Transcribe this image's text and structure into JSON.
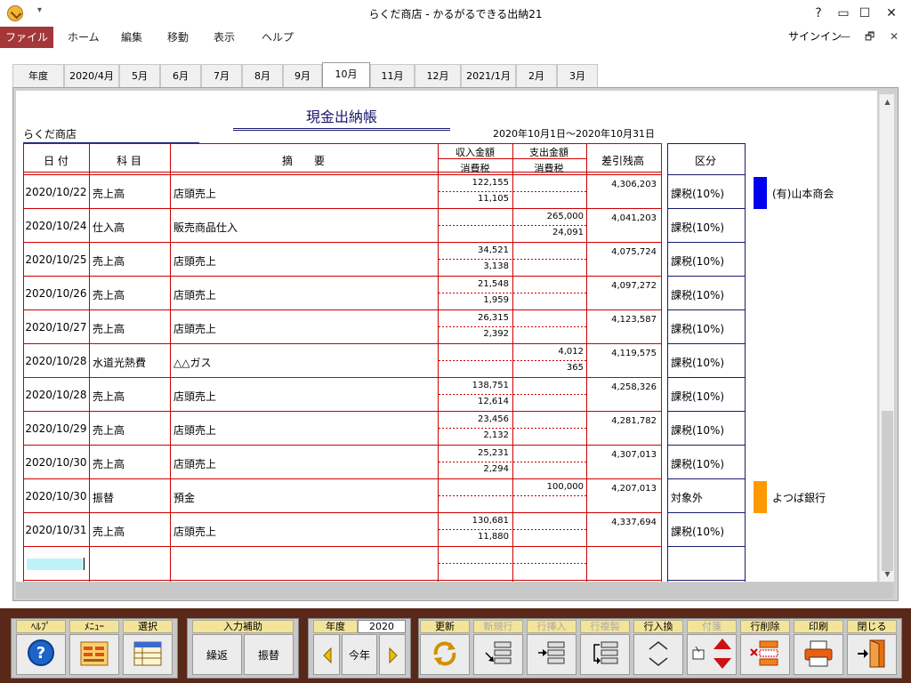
{
  "window": {
    "title": "らくだ商店 - かるがるできる出納21",
    "qat": "▾",
    "help": "?",
    "restore": "▭",
    "minimize": "—",
    "maximize": "☐",
    "close": "✕"
  },
  "menu": {
    "file": "ファイル",
    "items": [
      "ホーム",
      "編集",
      "移動",
      "表示",
      "ヘルプ"
    ],
    "signin": "サインイン",
    "min": "—",
    "restore": "🗗",
    "close": "✕"
  },
  "tabs": [
    "年度",
    "2020/4月",
    "5月",
    "6月",
    "7月",
    "8月",
    "9月",
    "10月",
    "11月",
    "12月",
    "2021/1月",
    "2月",
    "3月"
  ],
  "active_tab": "10月",
  "ledger": {
    "title": "現金出納帳",
    "shop": "らくだ商店",
    "period": "2020年10月1日～2020年10月31日",
    "headers": {
      "date": "日 付",
      "account": "科 目",
      "desc": "摘　　要",
      "income": "収入金額",
      "income_tax": "消費税",
      "expense": "支出金額",
      "expense_tax": "消費税",
      "balance": "差引残高",
      "category": "区分"
    },
    "rows": [
      {
        "date": "2020/10/22",
        "account": "売上高",
        "desc": "店頭売上",
        "income": "122,155",
        "income_tax": "11,105",
        "expense": "",
        "expense_tax": "",
        "balance": "4,306,203",
        "category": "課税(10%)",
        "partner": "(有)山本商会",
        "partner_color": "#0000ee"
      },
      {
        "date": "2020/10/24",
        "account": "仕入高",
        "desc": "販売商品仕入",
        "income": "",
        "income_tax": "",
        "expense": "265,000",
        "expense_tax": "24,091",
        "balance": "4,041,203",
        "category": "課税(10%)",
        "partner": "",
        "partner_color": ""
      },
      {
        "date": "2020/10/25",
        "account": "売上高",
        "desc": "店頭売上",
        "income": "34,521",
        "income_tax": "3,138",
        "expense": "",
        "expense_tax": "",
        "balance": "4,075,724",
        "category": "課税(10%)",
        "partner": "",
        "partner_color": ""
      },
      {
        "date": "2020/10/26",
        "account": "売上高",
        "desc": "店頭売上",
        "income": "21,548",
        "income_tax": "1,959",
        "expense": "",
        "expense_tax": "",
        "balance": "4,097,272",
        "category": "課税(10%)",
        "partner": "",
        "partner_color": ""
      },
      {
        "date": "2020/10/27",
        "account": "売上高",
        "desc": "店頭売上",
        "income": "26,315",
        "income_tax": "2,392",
        "expense": "",
        "expense_tax": "",
        "balance": "4,123,587",
        "category": "課税(10%)",
        "partner": "",
        "partner_color": ""
      },
      {
        "date": "2020/10/28",
        "account": "水道光熱費",
        "desc": "△△ガス",
        "income": "",
        "income_tax": "",
        "expense": "4,012",
        "expense_tax": "365",
        "balance": "4,119,575",
        "category": "課税(10%)",
        "partner": "",
        "partner_color": ""
      },
      {
        "date": "2020/10/28",
        "account": "売上高",
        "desc": "店頭売上",
        "income": "138,751",
        "income_tax": "12,614",
        "expense": "",
        "expense_tax": "",
        "balance": "4,258,326",
        "category": "課税(10%)",
        "partner": "",
        "partner_color": ""
      },
      {
        "date": "2020/10/29",
        "account": "売上高",
        "desc": "店頭売上",
        "income": "23,456",
        "income_tax": "2,132",
        "expense": "",
        "expense_tax": "",
        "balance": "4,281,782",
        "category": "課税(10%)",
        "partner": "",
        "partner_color": ""
      },
      {
        "date": "2020/10/30",
        "account": "売上高",
        "desc": "店頭売上",
        "income": "25,231",
        "income_tax": "2,294",
        "expense": "",
        "expense_tax": "",
        "balance": "4,307,013",
        "category": "課税(10%)",
        "partner": "",
        "partner_color": ""
      },
      {
        "date": "2020/10/30",
        "account": "振替",
        "desc": "預金",
        "income": "",
        "income_tax": "",
        "expense": "100,000",
        "expense_tax": "",
        "balance": "4,207,013",
        "category": "対象外",
        "partner": "よつば銀行",
        "partner_color": "#ff9900"
      },
      {
        "date": "2020/10/31",
        "account": "売上高",
        "desc": "店頭売上",
        "income": "130,681",
        "income_tax": "11,880",
        "expense": "",
        "expense_tax": "",
        "balance": "4,337,694",
        "category": "課税(10%)",
        "partner": "",
        "partner_color": ""
      }
    ]
  },
  "toolbar": {
    "help": "ﾍﾙﾌﾟ",
    "menu": "ﾒﾆｭｰ",
    "select": "選択",
    "input_assist": "入力補助",
    "repeat": "繰返",
    "transfer": "振替",
    "year_label": "年度",
    "year_value": "2020",
    "this_year": "今年",
    "update": "更新",
    "new_row": "新規行",
    "insert_row": "行挿入",
    "copy_row": "行複製",
    "swap_row": "行入換",
    "tag": "付箋",
    "delete_row": "行削除",
    "print": "印刷",
    "close": "閉じる"
  },
  "colors": {
    "grid_red": "#cc0000",
    "grid_blue": "#1a1a6e",
    "file_menu": "#a4373a",
    "toolbar_bg": "#5a2818",
    "button_label": "#f4e49a"
  }
}
